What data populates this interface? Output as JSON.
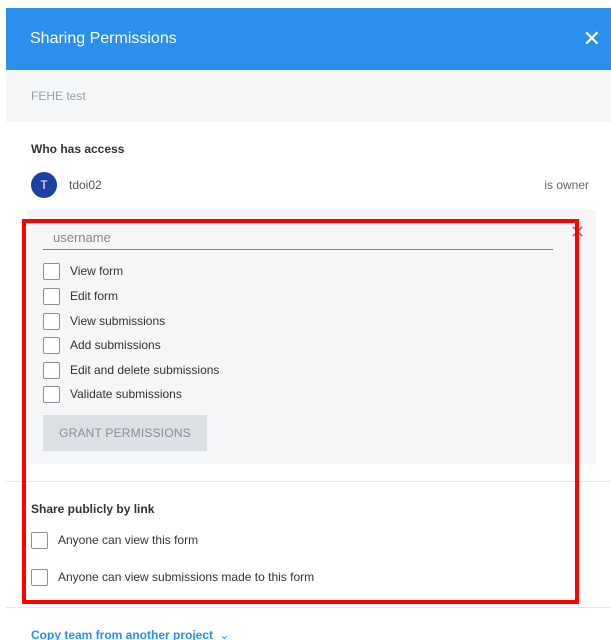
{
  "dialog": {
    "title": "Sharing Permissions",
    "close_icon": "✕",
    "form_name": "FEHE test"
  },
  "access": {
    "heading": "Who has access",
    "user": {
      "initial": "T",
      "name": "tdoi02",
      "role": "is owner"
    }
  },
  "grant": {
    "username_placeholder": "username",
    "username_value": "",
    "remove_icon": "✕",
    "permissions": [
      {
        "label": "View form",
        "checked": false
      },
      {
        "label": "Edit form",
        "checked": false
      },
      {
        "label": "View submissions",
        "checked": false
      },
      {
        "label": "Add submissions",
        "checked": false
      },
      {
        "label": "Edit and delete submissions",
        "checked": false
      },
      {
        "label": "Validate submissions",
        "checked": false
      }
    ],
    "button_label": "GRANT PERMISSIONS"
  },
  "public_share": {
    "heading": "Share publicly by link",
    "options": [
      {
        "label": "Anyone can view this form",
        "checked": false
      },
      {
        "label": "Anyone can view submissions made to this form",
        "checked": false
      }
    ]
  },
  "footer": {
    "copy_team_link": "Copy team from another project"
  },
  "colors": {
    "header_bg": "#2b8fed",
    "highlight": "#ff0000",
    "avatar_bg": "#1c3fa0"
  }
}
